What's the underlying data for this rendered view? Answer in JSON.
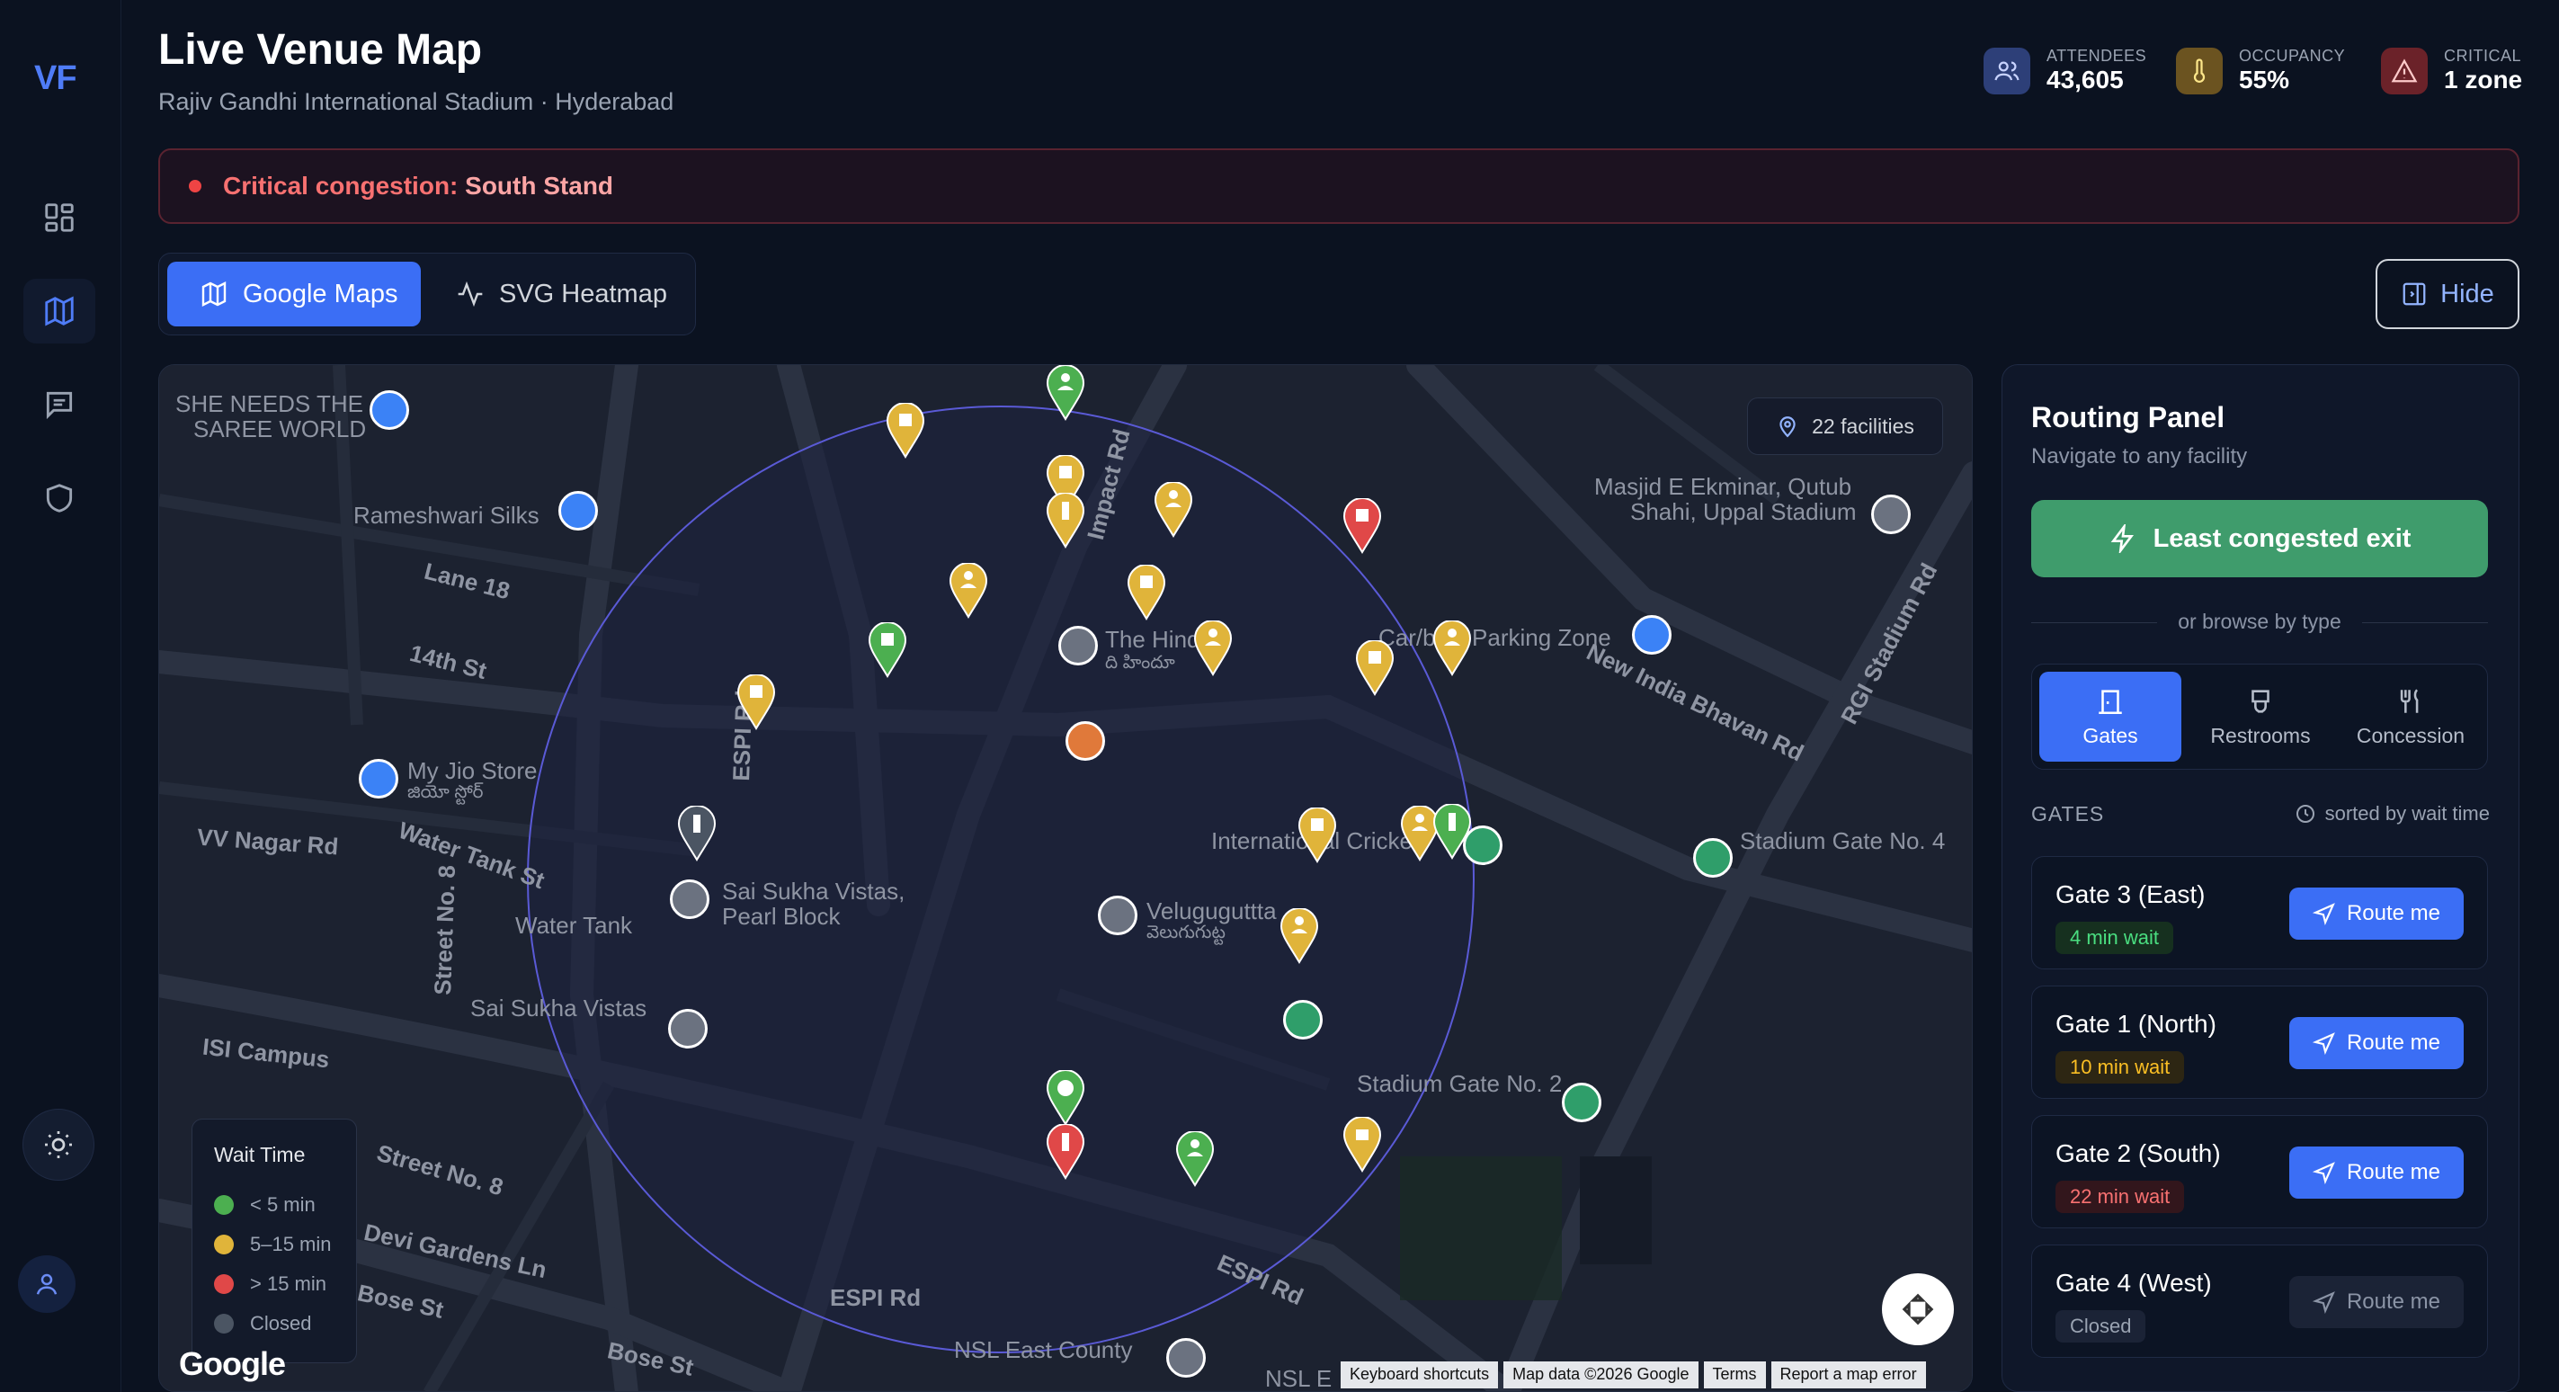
{
  "sidebar": {
    "logo": "VF"
  },
  "header": {
    "title": "Live Venue Map",
    "subtitle": "Rajiv Gandhi International Stadium · Hyderabad",
    "stats": [
      {
        "label": "ATTENDEES",
        "value": "43,605",
        "color": "#4f6fd8"
      },
      {
        "label": "OCCUPANCY",
        "value": "55%",
        "color": "#c7962e"
      },
      {
        "label": "CRITICAL",
        "value": "1 zone",
        "color": "#c2404a"
      }
    ]
  },
  "alert": {
    "prefix": "Critical congestion: ",
    "zone": "South Stand"
  },
  "view_tabs": {
    "google": "Google Maps",
    "svg": "SVG Heatmap",
    "hide": "Hide"
  },
  "map": {
    "facilities_badge": "22 facilities",
    "labels": {
      "saree1": "SHE NEEDS THE",
      "saree2": "SAREE WORLD",
      "rameshwari": "Rameshwari Silks",
      "lane18": "Lane 18",
      "st14": "14th St",
      "jio": "My Jio Store",
      "jio_te": "జియో స్టోర్",
      "vvnagar": "VV Nagar Rd",
      "watertank": "Water Tank St",
      "watertank2": "Water Tank",
      "sukha1": "Sai Sukha Vistas,",
      "sukha2": "Pearl Block",
      "sukha3": "Sai Sukha Vistas",
      "isi": "ISI Campus",
      "street8": "Street No. 8",
      "street8b": "Street No. 8",
      "devi": "Devi Gardens Ln",
      "bose": "Bose St",
      "bose2": "Bose St",
      "espi": "ESPI Rd",
      "espi2": "ESPI Rd",
      "espi3": "ESPI Rd",
      "impact": "Impact Rd",
      "hindu": "The Hindu",
      "hindu_te": "ది హిందూ",
      "parking": "Car/bike Parking Zone",
      "masjid1": "Masjid E Ekminar, Qutub",
      "masjid2": "Shahi, Uppal Stadium",
      "newindia": "New India Bhavan Rd",
      "rgi": "RGI Stadium Rd",
      "gate4": "Stadium Gate No. 4",
      "gate2": "Stadium Gate No. 2",
      "intl": "International Cricket",
      "velu": "Veluguguttta",
      "velu_te": "వెలుగుగుట్ట",
      "nsl": "NSL East County",
      "nsl2": "NSL E"
    },
    "legend": {
      "title": "Wait Time",
      "items": [
        {
          "label": "< 5 min",
          "color": "#4caf50"
        },
        {
          "label": "5–15 min",
          "color": "#e0b43a"
        },
        {
          "label": "> 15 min",
          "color": "#e04848"
        },
        {
          "label": "Closed",
          "color": "#4b5563"
        }
      ]
    },
    "google_logo": "Google",
    "attribution": [
      "Keyboard shortcuts",
      "Map data ©2026 Google",
      "Terms",
      "Report a map error"
    ]
  },
  "panel": {
    "title": "Routing Panel",
    "subtitle": "Navigate to any facility",
    "least_congested": "Least congested exit",
    "or_browse": "or browse by type",
    "types": [
      "Gates",
      "Restrooms",
      "Concession"
    ],
    "gates_heading": "GATES",
    "sorted": "sorted by wait time",
    "route_label": "Route me",
    "gates": [
      {
        "name": "Gate 3 (East)",
        "wait": "4 min wait",
        "color": "#4ade80",
        "bg": "#16301f",
        "enabled": true
      },
      {
        "name": "Gate 1 (North)",
        "wait": "10 min wait",
        "color": "#fbbf24",
        "bg": "#2d2613",
        "enabled": true
      },
      {
        "name": "Gate 2 (South)",
        "wait": "22 min wait",
        "color": "#f87171",
        "bg": "#32161c",
        "enabled": true
      },
      {
        "name": "Gate 4 (West)",
        "wait": "Closed",
        "color": "#9aa3b2",
        "bg": "#1b2336",
        "enabled": false
      }
    ]
  }
}
